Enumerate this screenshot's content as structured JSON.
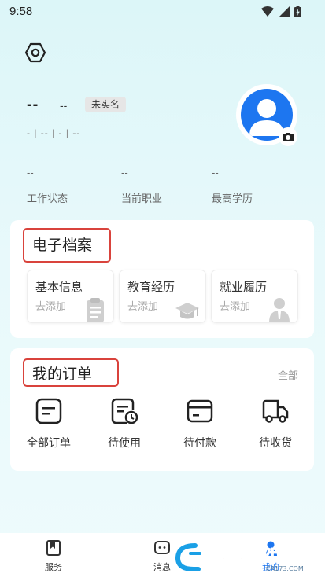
{
  "status_bar": {
    "time": "9:58"
  },
  "profile": {
    "name": "--",
    "name_sub": "--",
    "verify_badge": "未实名",
    "meta": "- | -- | - | --",
    "stats": [
      {
        "value": "--",
        "label": "工作状态"
      },
      {
        "value": "--",
        "label": "当前职业"
      },
      {
        "value": "--",
        "label": "最高学历"
      }
    ]
  },
  "archive": {
    "title": "电子档案",
    "tiles": [
      {
        "title": "基本信息",
        "sub": "去添加",
        "icon": "clipboard-icon"
      },
      {
        "title": "教育经历",
        "sub": "去添加",
        "icon": "graduation-cap-icon"
      },
      {
        "title": "就业履历",
        "sub": "去添加",
        "icon": "worker-icon"
      }
    ]
  },
  "orders": {
    "title": "我的订单",
    "all_label": "全部",
    "items": [
      {
        "label": "全部订单",
        "icon": "order-list-icon"
      },
      {
        "label": "待使用",
        "icon": "pending-use-icon"
      },
      {
        "label": "待付款",
        "icon": "card-payment-icon"
      },
      {
        "label": "待收货",
        "icon": "delivery-truck-icon"
      }
    ]
  },
  "tabbar": {
    "tabs": [
      {
        "label": "服务",
        "icon": "bookmark-icon"
      },
      {
        "label": "消息",
        "icon": "chat-icon"
      },
      {
        "label": "我的",
        "icon": "profile-icon"
      }
    ]
  },
  "watermark": {
    "text": "西西软件园",
    "domain": "CR173.COM"
  },
  "colors": {
    "accent": "#1d76f0",
    "highlight_border": "#d9433c",
    "background": "#dcf6f8"
  }
}
